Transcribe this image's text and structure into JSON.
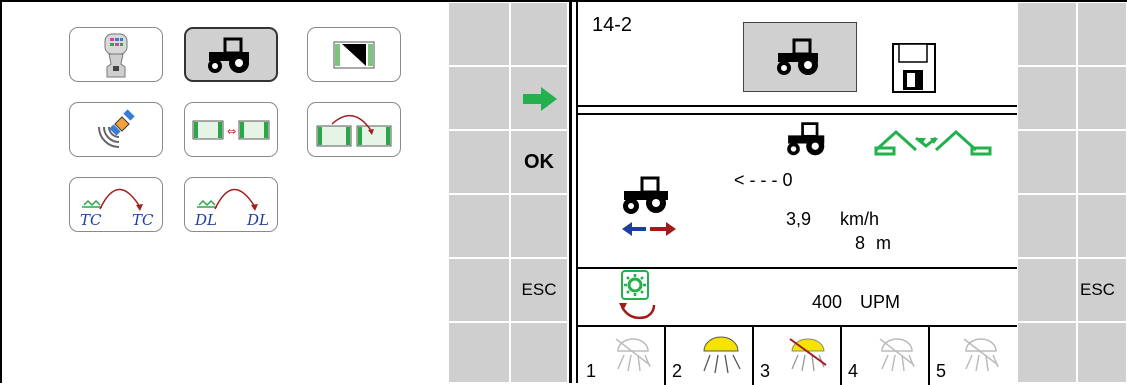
{
  "softkeys_left": {
    "ok_label": "OK",
    "esc_label": "ESC"
  },
  "softkeys_right": {
    "esc_label": "ESC"
  },
  "mask": {
    "page_id": "14-2",
    "reverse_indicator": "< - - - 0",
    "speed_value": "3,9",
    "speed_unit": "km/h",
    "distance_value": "8",
    "distance_unit": "m",
    "pto_value": "400",
    "pto_unit": "UPM",
    "work_lights": [
      "1",
      "2",
      "3",
      "4",
      "5"
    ]
  },
  "colors": {
    "softkey_grey": "#cfcfcf",
    "accent_green": "#22b14c",
    "arrow_blue": "#1f3f9a",
    "arrow_red": "#a01c1c",
    "light_yellow": "#f5e400"
  }
}
